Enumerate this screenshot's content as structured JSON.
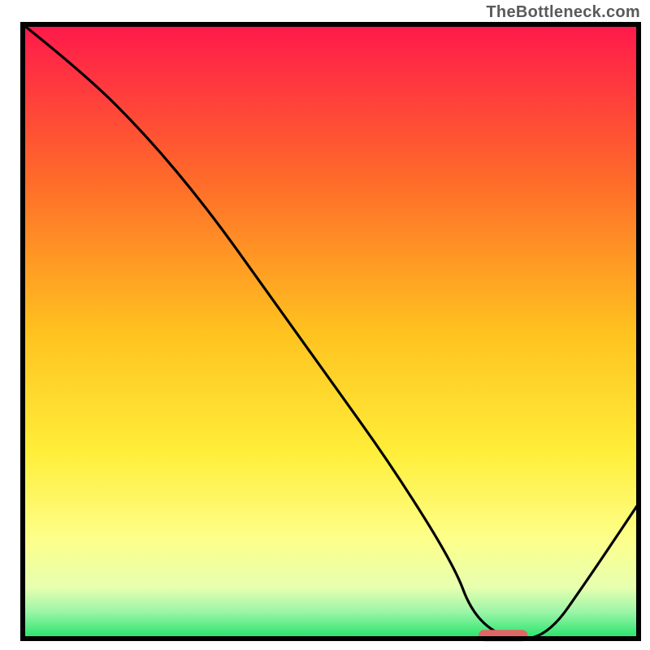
{
  "watermark": "TheBottleneck.com",
  "chart_data": {
    "type": "line",
    "title": "",
    "xlabel": "",
    "ylabel": "",
    "xlim": [
      0,
      100
    ],
    "ylim": [
      0,
      100
    ],
    "grid": false,
    "legend": false,
    "annotations": [],
    "series": [
      {
        "name": "curve",
        "x": [
          0,
          10,
          20,
          30,
          40,
          50,
          60,
          70,
          73,
          78,
          85,
          92,
          100
        ],
        "values": [
          100,
          92,
          82,
          70,
          56,
          42,
          28,
          12,
          4,
          0,
          0,
          10,
          22
        ]
      }
    ],
    "optimum_marker": {
      "x_start": 74,
      "x_end": 82,
      "y": 0.5
    },
    "background_gradient": {
      "stops": [
        {
          "offset": 0,
          "color": "#ff1a4b"
        },
        {
          "offset": 25,
          "color": "#ff6a2a"
        },
        {
          "offset": 50,
          "color": "#ffc21f"
        },
        {
          "offset": 70,
          "color": "#ffee3a"
        },
        {
          "offset": 84,
          "color": "#fdff8a"
        },
        {
          "offset": 92,
          "color": "#e7ffb0"
        },
        {
          "offset": 96,
          "color": "#9cf5a8"
        },
        {
          "offset": 100,
          "color": "#2ee56f"
        }
      ]
    },
    "frame_color": "#000000",
    "curve_color": "#000000",
    "marker_color": "#e06666"
  }
}
